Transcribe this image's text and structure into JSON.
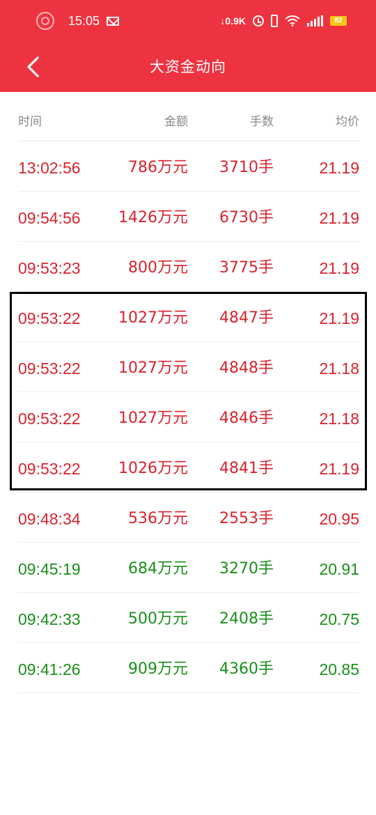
{
  "status_bar": {
    "time": "15:05",
    "net_speed": "0.9K",
    "battery": "82",
    "icons": [
      "record-icon",
      "mail-icon",
      "alarm-icon",
      "vibrate-icon",
      "wifi-icon",
      "signal-icon",
      "battery-icon"
    ]
  },
  "header": {
    "title": "大资金动向",
    "back_icon": "chevron-left-icon",
    "background": "#ee3340"
  },
  "columns": [
    "时间",
    "金额",
    "手数",
    "均价"
  ],
  "colors": {
    "up": "#d9232e",
    "down": "#1a8f1a"
  },
  "rows": [
    {
      "time": "13:02:56",
      "amount": "786万元",
      "lots": "3710手",
      "price": "21.19",
      "dir": "up"
    },
    {
      "time": "09:54:56",
      "amount": "1426万元",
      "lots": "6730手",
      "price": "21.19",
      "dir": "up"
    },
    {
      "time": "09:53:23",
      "amount": "800万元",
      "lots": "3775手",
      "price": "21.19",
      "dir": "up"
    },
    {
      "time": "09:53:22",
      "amount": "1027万元",
      "lots": "4847手",
      "price": "21.19",
      "dir": "up"
    },
    {
      "time": "09:53:22",
      "amount": "1027万元",
      "lots": "4848手",
      "price": "21.18",
      "dir": "up"
    },
    {
      "time": "09:53:22",
      "amount": "1027万元",
      "lots": "4846手",
      "price": "21.18",
      "dir": "up"
    },
    {
      "time": "09:53:22",
      "amount": "1026万元",
      "lots": "4841手",
      "price": "21.19",
      "dir": "up"
    },
    {
      "time": "09:48:34",
      "amount": "536万元",
      "lots": "2553手",
      "price": "20.95",
      "dir": "up"
    },
    {
      "time": "09:45:19",
      "amount": "684万元",
      "lots": "3270手",
      "price": "20.91",
      "dir": "down"
    },
    {
      "time": "09:42:33",
      "amount": "500万元",
      "lots": "2408手",
      "price": "20.75",
      "dir": "down"
    },
    {
      "time": "09:41:26",
      "amount": "909万元",
      "lots": "4360手",
      "price": "20.85",
      "dir": "down"
    }
  ]
}
